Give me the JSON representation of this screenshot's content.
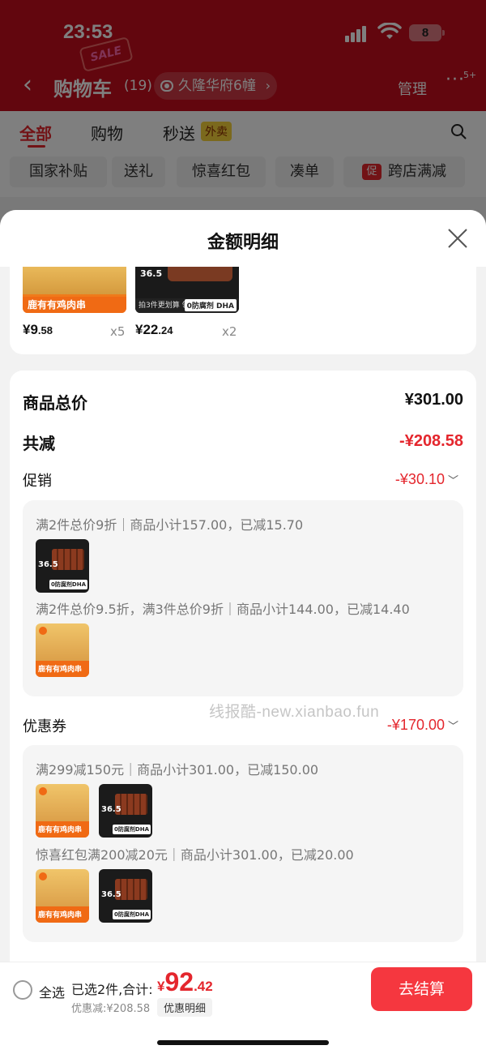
{
  "status": {
    "time": "23:53",
    "battery": "8"
  },
  "header": {
    "title": "购物车",
    "count": "(19)",
    "address": "久隆华府6幢",
    "manage": "管理",
    "more_badge": "5+",
    "decoration_text": "SALE"
  },
  "tabs": [
    {
      "label": "全部"
    },
    {
      "label": "购物"
    },
    {
      "label": "秒送"
    }
  ],
  "tab_tag": "外卖",
  "chips": [
    {
      "label": "国家补贴"
    },
    {
      "label": "送礼"
    },
    {
      "label": "惊喜红包"
    },
    {
      "label": "凑单"
    },
    {
      "label": "跨店满减",
      "badge": "促"
    }
  ],
  "sheet": {
    "title": "金额明细",
    "products": [
      {
        "name": "鹿有有鸡肉串",
        "price_int": "¥9",
        "price_dec": ".58",
        "qty": "x5"
      },
      {
        "name": "0防腐剂 DHA",
        "price_int": "¥22",
        "price_dec": ".24",
        "qty": "x2",
        "badge_num": "36.5",
        "bar_text": "拍3件更划算 领券下单"
      }
    ],
    "total_label": "商品总价",
    "total_value": "¥301.00",
    "reduce_label": "共减",
    "reduce_value": "-¥208.58",
    "promo": {
      "label": "促销",
      "value": "-¥30.10",
      "lines": [
        "满2件总价9折｜商品小计157.00，已减15.70",
        "满2件总价9.5折，满3件总价9折｜商品小计144.00，已减14.40"
      ]
    },
    "coupon": {
      "label": "优惠券",
      "value": "-¥170.00",
      "lines": [
        "满299减150元｜商品小计301.00，已减150.00",
        "惊喜红包满200减20元｜商品小计301.00，已减20.00"
      ]
    },
    "watermark": "线报酷-new.xianbao.fun"
  },
  "bottom": {
    "select_all": "全选",
    "summary": "已选2件,合计:",
    "total_symbol": "¥",
    "total_int": "92",
    "total_dec": ".42",
    "savings": "优惠减:¥208.58",
    "detail_button": "优惠明细",
    "checkout": "去结算"
  },
  "colors": {
    "accent": "#e4262d",
    "header": "#c40d1c",
    "checkout": "#f5373f"
  }
}
